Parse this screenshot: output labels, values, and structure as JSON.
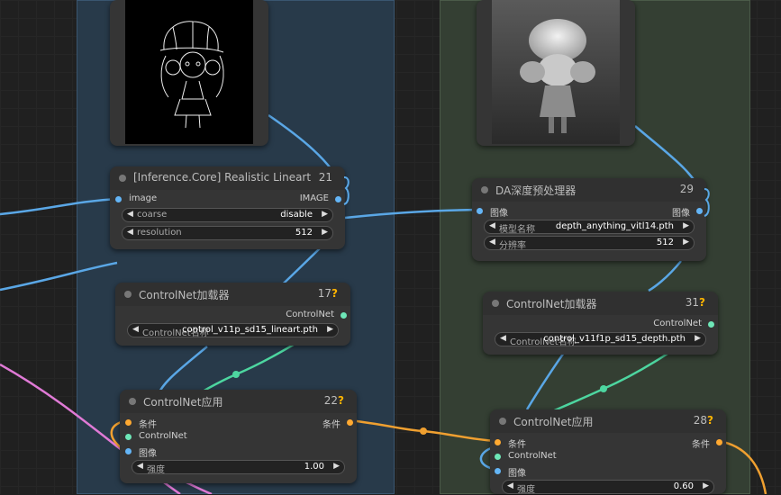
{
  "colors": {
    "image_wire": "#5aa7e6",
    "conditioning_wire": "#f0a030",
    "controlnet_wire": "#4dd6a0",
    "clip_wire": "#e07ad6",
    "group_blue": "#283a4a",
    "group_green": "#343f33"
  },
  "nodes": {
    "lineart": {
      "title": "[Inference.Core] Realistic Lineart",
      "id": "21",
      "input_image": "image",
      "output_image": "IMAGE",
      "widgets": [
        {
          "label": "coarse",
          "value": "disable"
        },
        {
          "label": "resolution",
          "value": "512"
        }
      ]
    },
    "depth": {
      "title": "DA深度预处理器",
      "id": "29",
      "input_image": "图像",
      "output_image": "图像",
      "widgets": [
        {
          "label": "模型名称",
          "value": "depth_anything_vitl14.pth"
        },
        {
          "label": "分辨率",
          "value": "512"
        }
      ]
    },
    "cn_loader_left": {
      "title": "ControlNet加载器",
      "id": "17",
      "badge": "?",
      "output": "ControlNet",
      "widget": {
        "label": "ControlNet名称",
        "value": "control_v11p_sd15_lineart.pth"
      }
    },
    "cn_loader_right": {
      "title": "ControlNet加载器",
      "id": "31",
      "badge": "?",
      "output": "ControlNet",
      "widget": {
        "label": "ControlNet名称",
        "value": "control_v11f1p_sd15_depth.pth"
      }
    },
    "cn_apply_left": {
      "title": "ControlNet应用",
      "id": "22",
      "badge": "?",
      "inputs": [
        "条件",
        "ControlNet",
        "图像"
      ],
      "output": "条件",
      "widget": {
        "label": "强度",
        "value": "1.00"
      }
    },
    "cn_apply_right": {
      "title": "ControlNet应用",
      "id": "28",
      "badge": "?",
      "inputs": [
        "条件",
        "ControlNet",
        "图像"
      ],
      "output": "条件",
      "widget": {
        "label": "强度",
        "value": "0.60"
      }
    }
  }
}
